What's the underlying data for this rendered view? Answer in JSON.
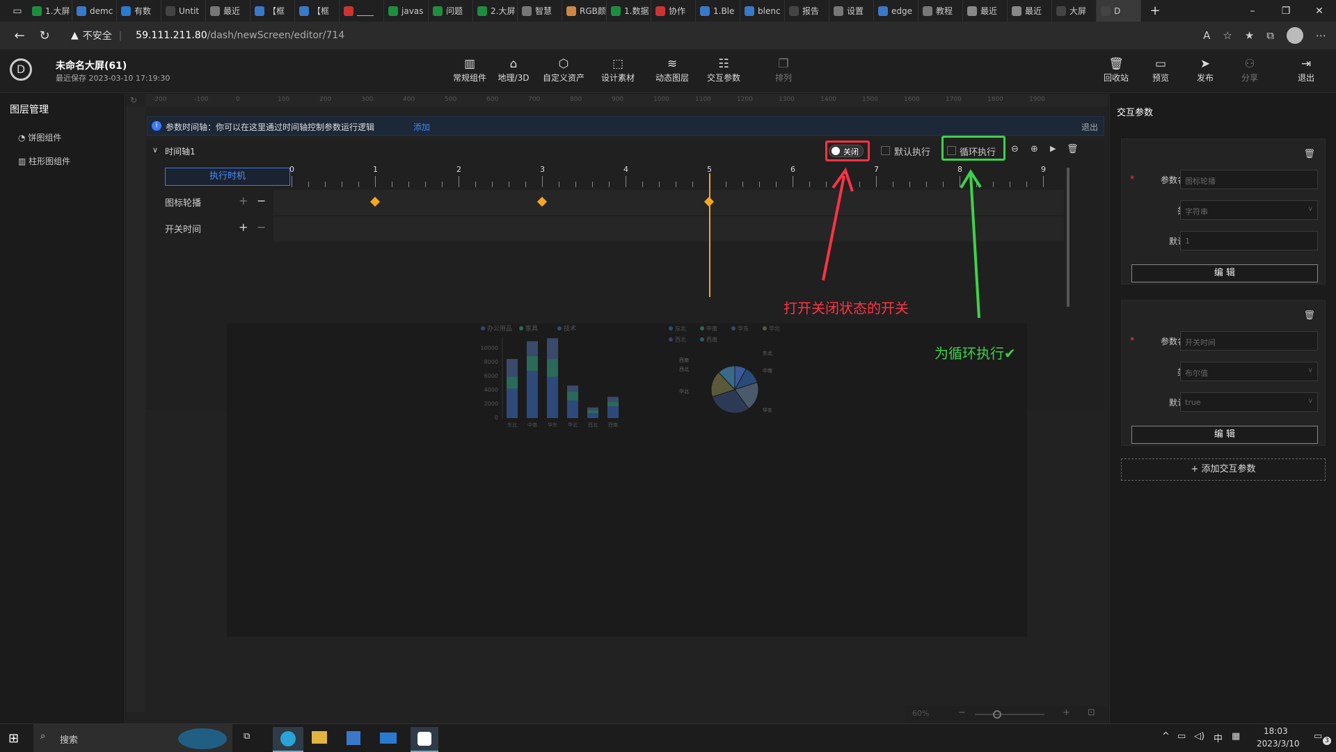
{
  "browser": {
    "tabs": [
      "1.大屏",
      "demc",
      "有数",
      "Untit",
      "最近",
      "【框",
      "【框",
      "____",
      "javas",
      "问题",
      "2.大屏",
      "智慧",
      "RGB颜",
      "1.数据",
      "协作",
      "1.Ble",
      "blenc",
      "报告",
      "设置",
      "edge",
      "教程",
      "最近",
      "最近",
      "大屏",
      "D"
    ],
    "url_warning": "不安全",
    "url_host": "59.111.211.80",
    "url_path": "/dash/newScreen/editor/714",
    "window": {
      "min": "–",
      "max": "❐",
      "close": "✕"
    }
  },
  "app": {
    "title": "未命名大屏(61)",
    "saved": "最近保存 2023-03-10 17:19:30",
    "tools": [
      "常规组件",
      "地理/3D",
      "自定义资产",
      "设计素材",
      "动态图层",
      "交互参数",
      "排列"
    ],
    "right_tools": [
      "回收站",
      "预览",
      "发布",
      "分享",
      "退出"
    ]
  },
  "sidebar": {
    "title": "图层管理",
    "items": [
      "饼图组件",
      "柱形图组件"
    ]
  },
  "timeline_bar": {
    "info": "参数时间轴：你可以在这里通过时间轴控制参数运行逻辑",
    "add": "添加",
    "exit": "退出"
  },
  "timeline": {
    "name": "时间轴1",
    "switch_label": "关闭",
    "default_exec": "默认执行",
    "loop_exec": "循环执行",
    "exec_btn": "执行时机",
    "ticks": [
      "0",
      "1",
      "2",
      "3",
      "4",
      "5",
      "6",
      "7",
      "8",
      "9"
    ],
    "tracks": [
      "图标轮播",
      "开关时间"
    ],
    "keyframes": [
      1,
      3,
      5
    ],
    "playhead": 5
  },
  "ruler": [
    "-200",
    "-100",
    "0",
    "100",
    "200",
    "300",
    "400",
    "500",
    "600",
    "700",
    "800",
    "900",
    "1000",
    "1100",
    "1200",
    "1300",
    "1400",
    "1500",
    "1600",
    "1700",
    "1800",
    "1900"
  ],
  "annotations": {
    "red": "打开关闭状态的开关",
    "green": "为循环执行✔"
  },
  "chart_preview": {
    "legend_bar": [
      "办公用品",
      "家具",
      "技术"
    ],
    "y_ticks": [
      "10000",
      "8000",
      "6000",
      "4000",
      "2000",
      "0"
    ],
    "x_ticks": [
      "东北",
      "中南",
      "华东",
      "华北",
      "西北",
      "西南"
    ],
    "legend_pie": [
      "东北",
      "中南",
      "华东",
      "华北",
      "西北",
      "西南"
    ],
    "pie_labels": [
      "西南",
      "西北",
      "华北",
      "东北",
      "中南",
      "华东"
    ]
  },
  "zoom": {
    "percent": "60%"
  },
  "right_panel": {
    "title": "交互参数",
    "params": [
      {
        "name_label": "参数名称",
        "name": "图标轮播",
        "type_label": "类型",
        "type": "字符串",
        "default_label": "默认值",
        "default": "1",
        "edit": "编 辑"
      },
      {
        "name_label": "参数名称",
        "name": "开关时间",
        "type_label": "类型",
        "type": "布尔值",
        "default_label": "默认值",
        "default": "true",
        "edit": "编 辑"
      }
    ],
    "add": "+ 添加交互参数"
  },
  "taskbar": {
    "search": "搜索",
    "time": "18:03",
    "date": "2023/3/10",
    "ime": "中",
    "notif": "3"
  }
}
